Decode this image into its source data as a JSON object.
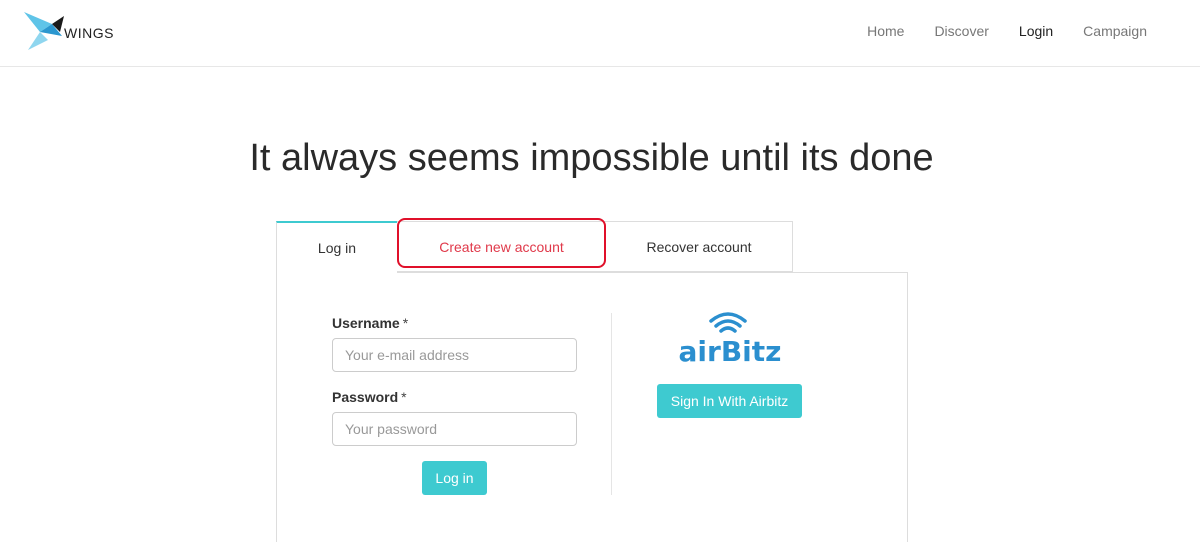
{
  "brand": {
    "name": "WINGS",
    "logo_icon": "bird-icon",
    "accent": "#3ecad0",
    "highlight": "#e0102a"
  },
  "nav": {
    "items": [
      {
        "label": "Home",
        "active": false
      },
      {
        "label": "Discover",
        "active": false
      },
      {
        "label": "Login",
        "active": true
      },
      {
        "label": "Campaign",
        "active": false
      }
    ]
  },
  "hero": {
    "title": "It always seems impossible until its done"
  },
  "tabs": [
    {
      "label": "Log in",
      "active": true
    },
    {
      "label": "Create new account",
      "active": false
    },
    {
      "label": "Recover account",
      "active": false
    }
  ],
  "form": {
    "username": {
      "label": "Username",
      "required_mark": "*",
      "placeholder": "Your e-mail address",
      "value": ""
    },
    "password": {
      "label": "Password",
      "required_mark": "*",
      "placeholder": "Your password",
      "value": ""
    },
    "submit_label": "Log in"
  },
  "airbitz": {
    "logo_text": "airBitz",
    "logo_icon": "wifi-icon",
    "button_label": "Sign In With Airbitz"
  }
}
